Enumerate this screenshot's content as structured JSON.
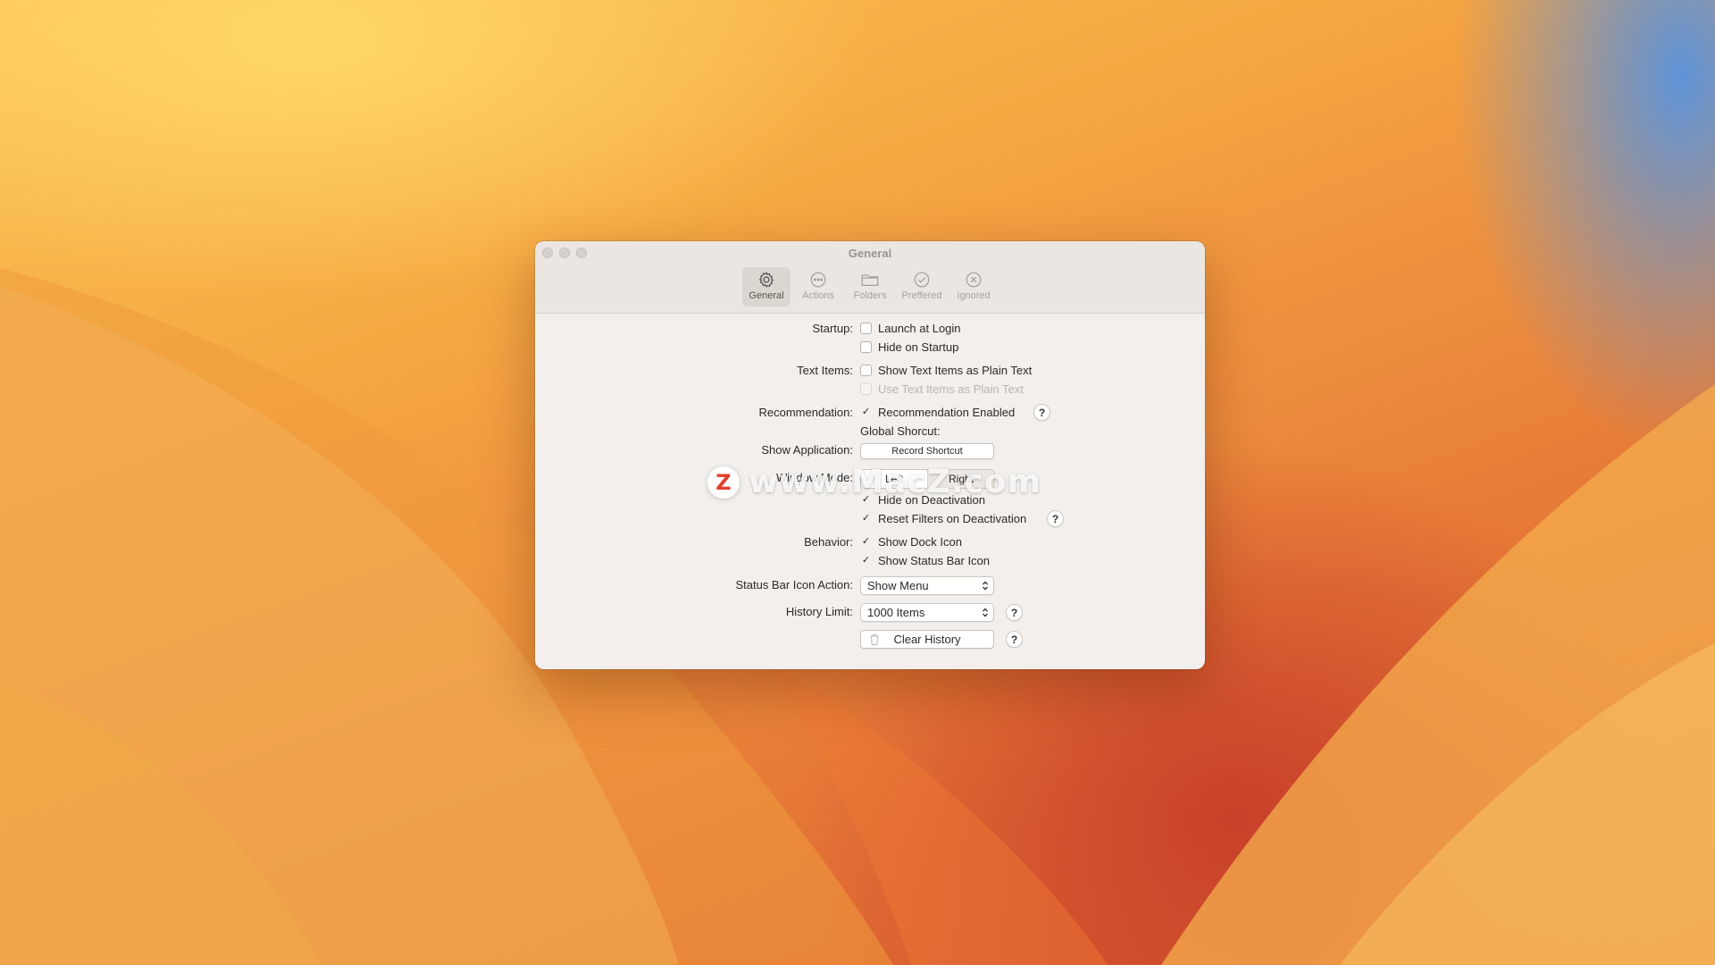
{
  "window": {
    "title": "General"
  },
  "tabs": [
    {
      "label": "General",
      "icon": "gear-icon",
      "active": true
    },
    {
      "label": "Actions",
      "icon": "ellipsis-circle-icon",
      "active": false
    },
    {
      "label": "Folders",
      "icon": "folder-icon",
      "active": false
    },
    {
      "label": "Preffered",
      "icon": "checkmark-circle-icon",
      "active": false
    },
    {
      "label": "Ignored",
      "icon": "xmark-circle-icon",
      "active": false
    }
  ],
  "settings": {
    "startup": {
      "label": "Startup:",
      "launch_at_login": {
        "label": "Launch at Login",
        "checked": false
      },
      "hide_on_startup": {
        "label": "Hide on Startup",
        "checked": false
      }
    },
    "text_items": {
      "label": "Text Items:",
      "show_plain": {
        "label": "Show Text Items as Plain Text",
        "checked": false
      },
      "use_plain": {
        "label": "Use Text Items as Plain Text",
        "checked": false,
        "disabled": true
      }
    },
    "recommendation": {
      "label": "Recommendation:",
      "enabled": {
        "label": "Recommendation Enabled",
        "checked": true
      },
      "help": "?"
    },
    "global_shortcut": {
      "label": "Global Shorcut:"
    },
    "show_application": {
      "label": "Show Application:",
      "button": "Record Shortcut"
    },
    "window_mode": {
      "label": "Window Mode:",
      "options": [
        "Left",
        "Right"
      ],
      "selected": "Right",
      "hide_on_deactivation": {
        "label": "Hide on Deactivation",
        "checked": true
      },
      "reset_filters": {
        "label": "Reset Filters on Deactivation",
        "checked": true
      },
      "help": "?"
    },
    "behavior": {
      "label": "Behavior:",
      "show_dock_icon": {
        "label": "Show Dock Icon",
        "checked": true
      },
      "show_status_bar_icon": {
        "label": "Show Status Bar Icon",
        "checked": true
      }
    },
    "status_bar_icon_action": {
      "label": "Status Bar Icon Action:",
      "value": "Show Menu"
    },
    "history_limit": {
      "label": "History Limit:",
      "value": "1000 Items",
      "help": "?"
    },
    "clear_history": {
      "button": "Clear History",
      "help": "?"
    }
  },
  "watermark": {
    "logo": "Z",
    "text": "www.MacZ.com"
  },
  "colors": {
    "window_bg": "#f3efec",
    "titlebar_bg": "#ebe6e2",
    "watermark_red": "#e2402a"
  }
}
